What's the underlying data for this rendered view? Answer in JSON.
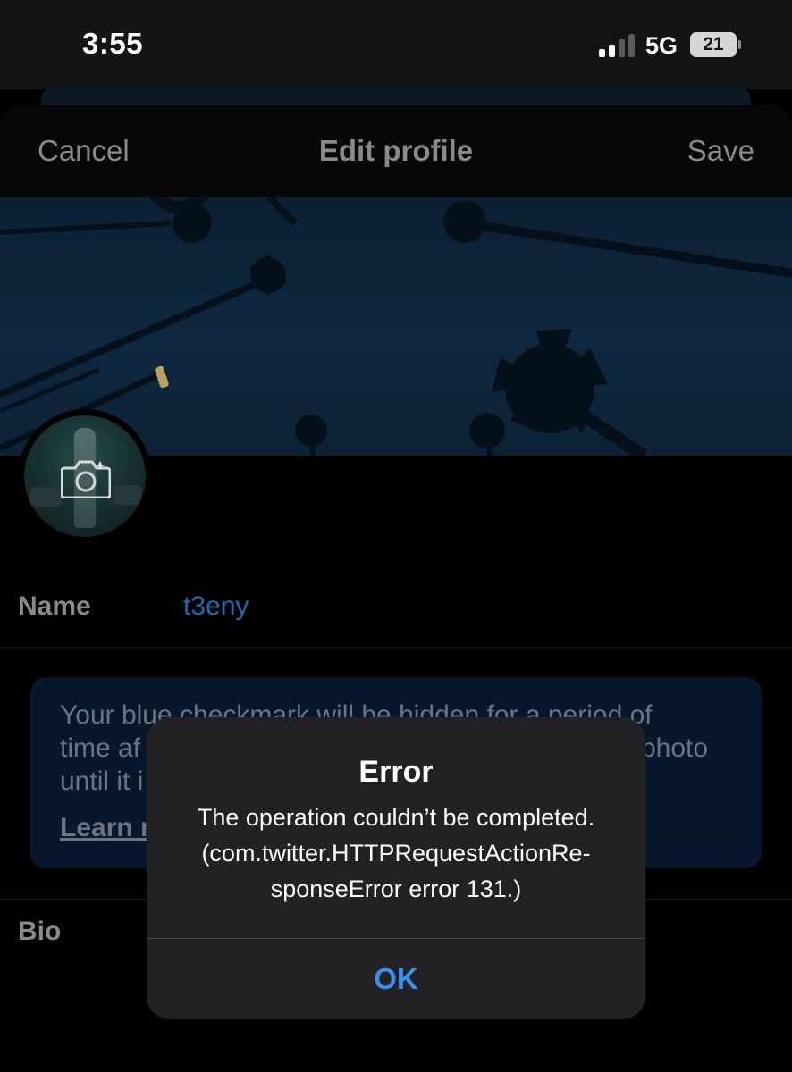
{
  "status_bar": {
    "time": "3:55",
    "network": "5G",
    "battery": "21",
    "signal_bars_active": 2,
    "signal_bars_total": 4
  },
  "nav": {
    "cancel_label": "Cancel",
    "title": "Edit profile",
    "save_label": "Save"
  },
  "profile": {
    "header_image": "palm-trees-night-photo",
    "avatar_image": "character-avatar",
    "camera_icon": "camera-icon"
  },
  "name_field": {
    "label": "Name",
    "value": "t3eny"
  },
  "info_card": {
    "text_lines": [
      "Your blue checkmark will be hidden for a period of",
      "time af",
      "until it i"
    ],
    "text_trailing": "photo",
    "learn_more": "Learn m"
  },
  "bio_field": {
    "label": "Bio"
  },
  "alert": {
    "title": "Error",
    "message_lines": [
      "The operation couldn’t be completed.",
      "(com.twitter.HTTPRequestActionRe-",
      "sponseError error 131.)"
    ],
    "ok_label": "OK"
  },
  "colors": {
    "link_blue": "#1a6eb0",
    "alert_button_blue": "#3a8ff0",
    "alert_background": "#222224",
    "info_card_background": "#08182c"
  }
}
